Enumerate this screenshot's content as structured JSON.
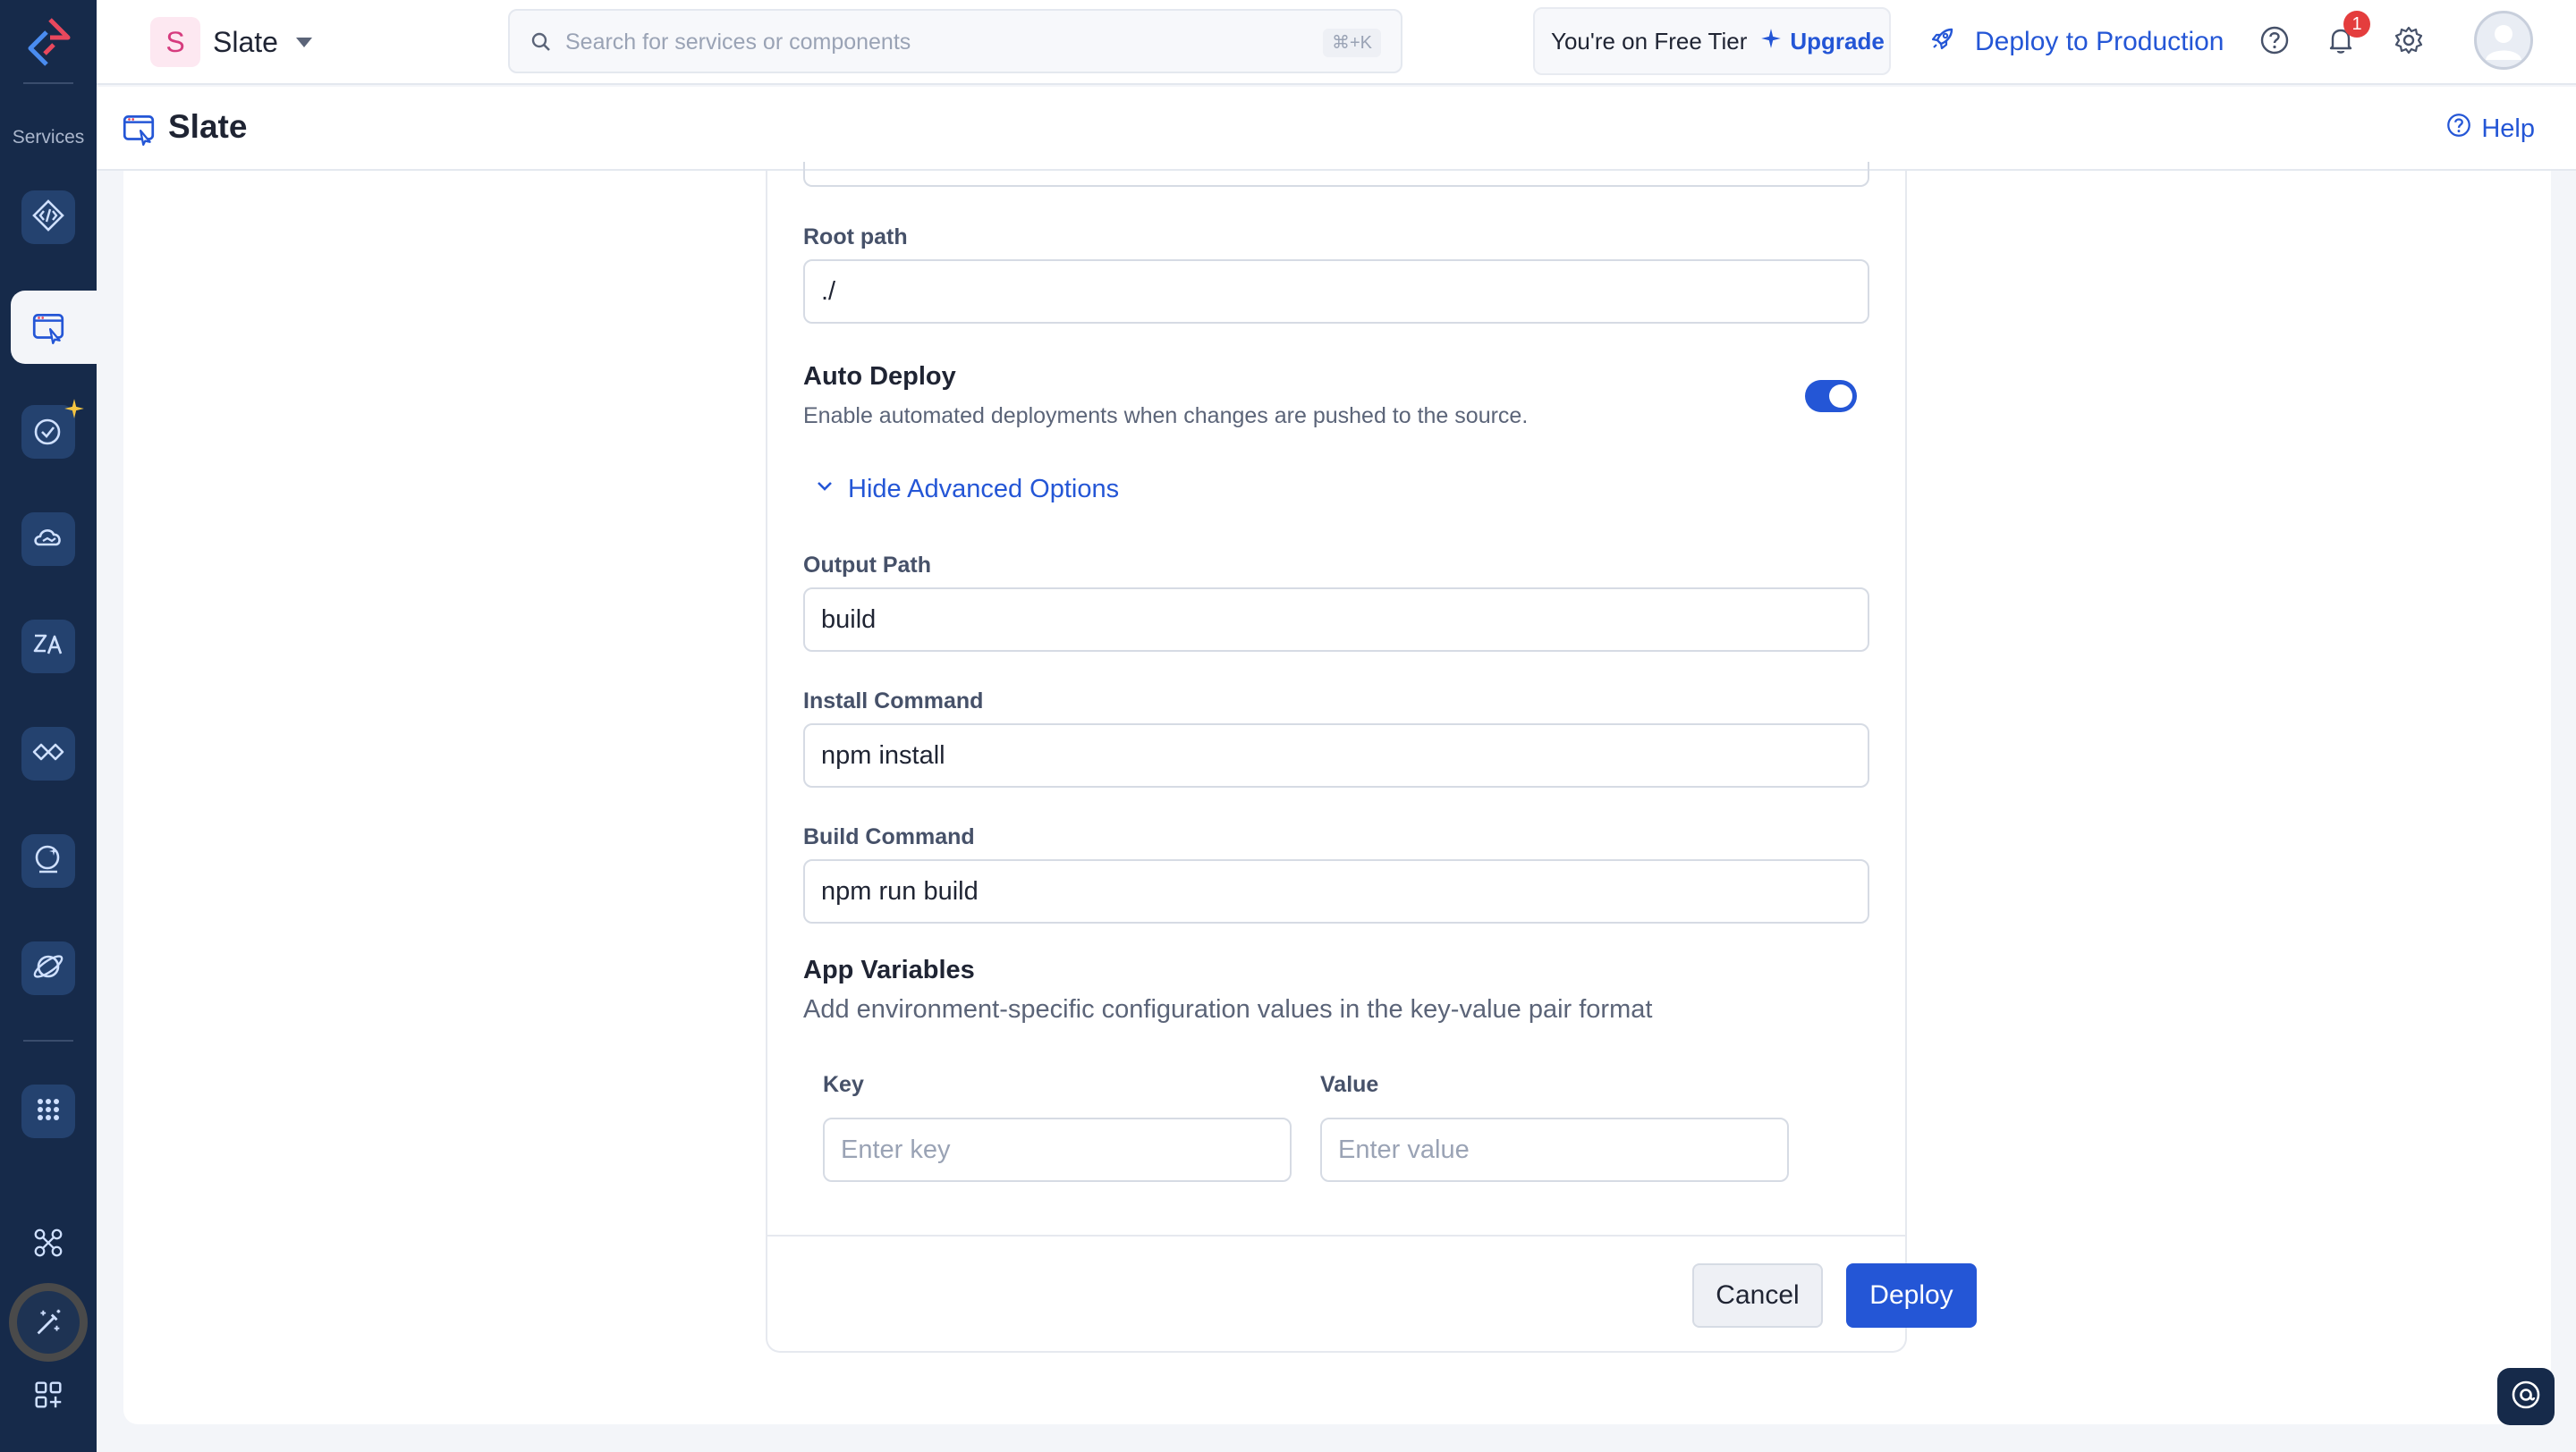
{
  "rail": {
    "services_label": "Services",
    "items": [
      {
        "name": "code-brackets-icon"
      },
      {
        "name": "slate-icon",
        "active": true
      },
      {
        "name": "ai-agent-icon"
      },
      {
        "name": "cloud-icon"
      },
      {
        "name": "translate-icon"
      },
      {
        "name": "api-icon"
      },
      {
        "name": "search-spark-icon"
      },
      {
        "name": "planet-icon"
      },
      {
        "name": "apps-grid-icon"
      },
      {
        "name": "workflow-icon"
      },
      {
        "name": "magic-wand-icon"
      },
      {
        "name": "add-widget-icon"
      }
    ]
  },
  "topbar": {
    "project_initial": "S",
    "project_name": "Slate",
    "search_placeholder": "Search for services or components",
    "search_shortcut": "⌘+K",
    "tier_text": "You're on Free Tier",
    "upgrade_label": "Upgrade",
    "deploy_prod_label": "Deploy to Production",
    "notifications_count": "1"
  },
  "page": {
    "title": "Slate",
    "help_label": "Help"
  },
  "form": {
    "root_path_label": "Root path",
    "root_path_value": "./",
    "auto_deploy_title": "Auto Deploy",
    "auto_deploy_desc": "Enable automated deployments when changes are pushed to the source.",
    "auto_deploy_on": true,
    "advanced_toggle_label": "Hide Advanced Options",
    "output_path_label": "Output Path",
    "output_path_value": "build",
    "install_command_label": "Install Command",
    "install_command_value": "npm install",
    "build_command_label": "Build Command",
    "build_command_value": "npm run build",
    "app_vars_title": "App Variables",
    "app_vars_desc": "Add environment-specific configuration values in the key-value pair format",
    "key_label": "Key",
    "key_placeholder": "Enter key",
    "value_label": "Value",
    "value_placeholder": "Enter value",
    "cancel_label": "Cancel",
    "deploy_label": "Deploy"
  },
  "colors": {
    "rail_bg": "#162a4a",
    "accent": "#2456d6",
    "badge": "#e43d3d"
  }
}
